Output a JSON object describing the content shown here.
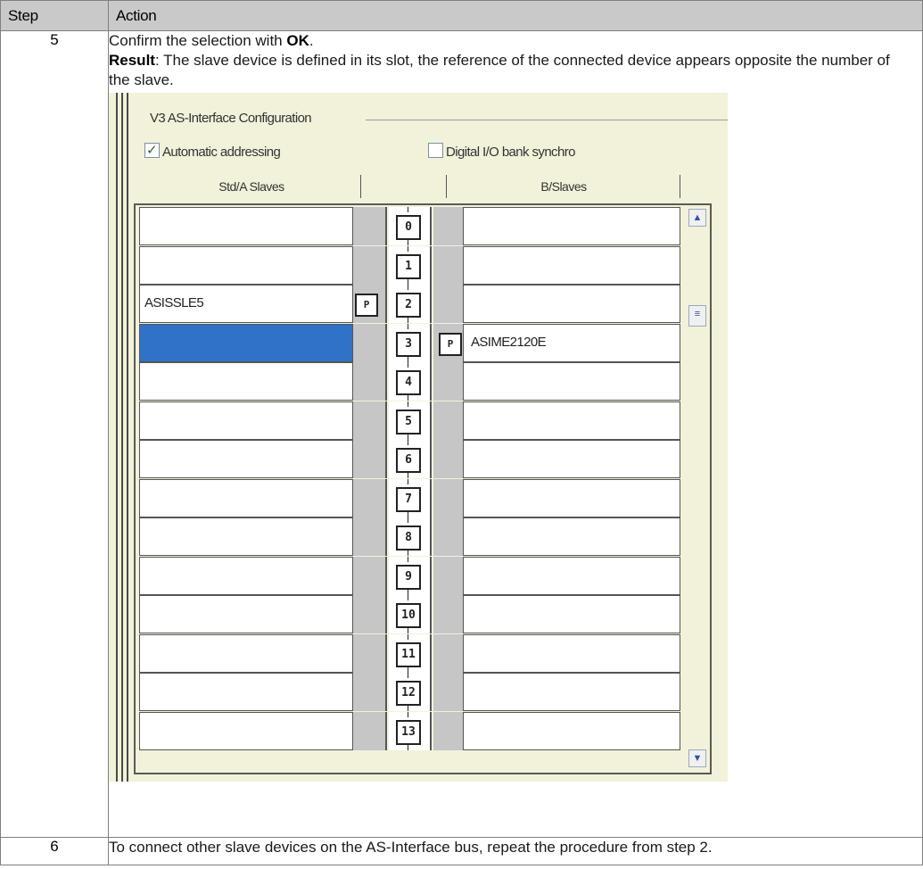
{
  "table": {
    "header_step": "Step",
    "header_action": "Action"
  },
  "step5": {
    "number": "5",
    "line1_prefix": "Confirm the selection with ",
    "line1_bold": "OK",
    "line1_suffix": ".",
    "line2_bold": "Result",
    "line2_text": ": The slave device is defined in its slot, the reference of the connected device appears opposite the number of the slave."
  },
  "screenshot": {
    "title": "V3 AS-Interface Configuration",
    "automatic_addressing": {
      "label": "Automatic addressing",
      "checked": true
    },
    "digital_io_bank_sync": {
      "label": "Digital I/O bank synchro",
      "checked": false
    },
    "col_std": "Std/A Slaves",
    "col_b": "B/Slaves",
    "rows": [
      {
        "num": "0"
      },
      {
        "num": "1"
      },
      {
        "num": "2",
        "left_device": "ASISSLE5",
        "left_p": "P"
      },
      {
        "num": "3",
        "right_device": "ASIME2120E",
        "right_p": "P",
        "left_selected": true
      },
      {
        "num": "4"
      },
      {
        "num": "5"
      },
      {
        "num": "6"
      },
      {
        "num": "7"
      },
      {
        "num": "8"
      },
      {
        "num": "9"
      },
      {
        "num": "10"
      },
      {
        "num": "11"
      },
      {
        "num": "12"
      },
      {
        "num": "13"
      }
    ],
    "scroll_up_icon": "chevron-up-icon",
    "scroll_down_icon": "chevron-down-icon"
  },
  "step6": {
    "number": "6",
    "text": "To connect other slave devices on the AS-Interface bus, repeat the procedure from step 2."
  }
}
